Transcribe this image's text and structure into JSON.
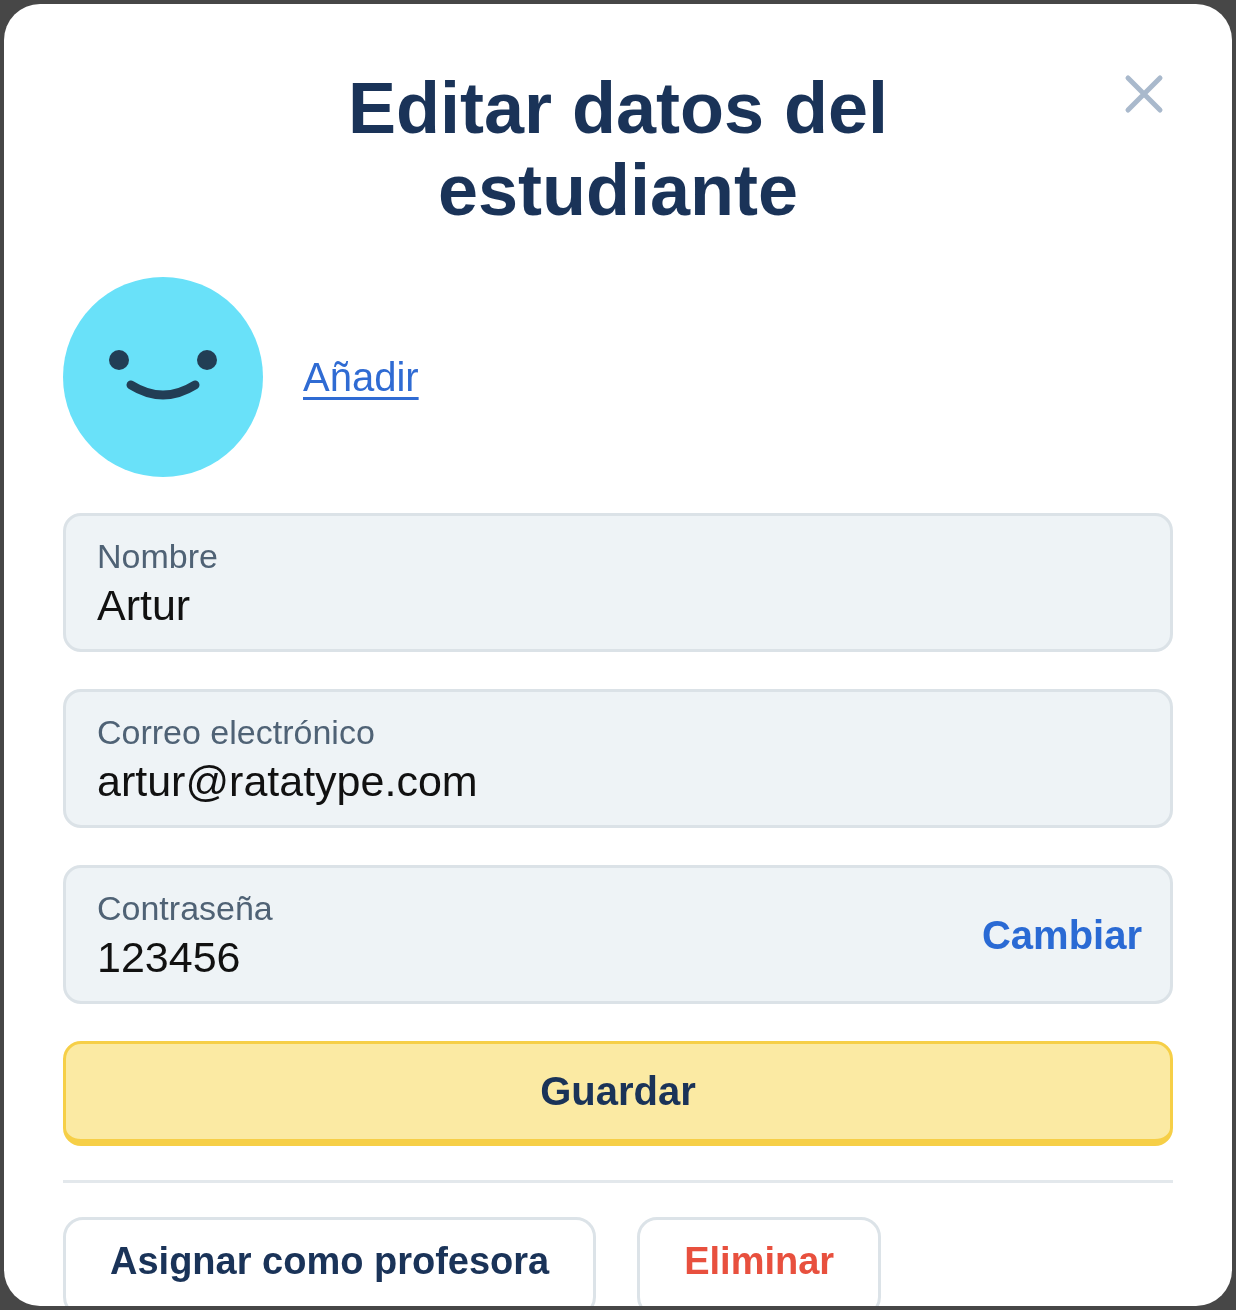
{
  "dialog": {
    "title": "Editar datos del estudiante"
  },
  "avatar": {
    "link": "Añadir"
  },
  "fields": [
    {
      "label": "Nombre",
      "value": "Artur"
    },
    {
      "label": "Correo electrónico",
      "value": "artur@ratatype.com"
    },
    {
      "label": "Contraseña",
      "value": "123456",
      "action": "Cambiar"
    }
  ],
  "primary_button": "Guardar",
  "secondary_buttons": [
    {
      "kind": "neutral",
      "label": "Asignar como profesora"
    },
    {
      "kind": "danger",
      "label": "Eliminar"
    }
  ]
}
